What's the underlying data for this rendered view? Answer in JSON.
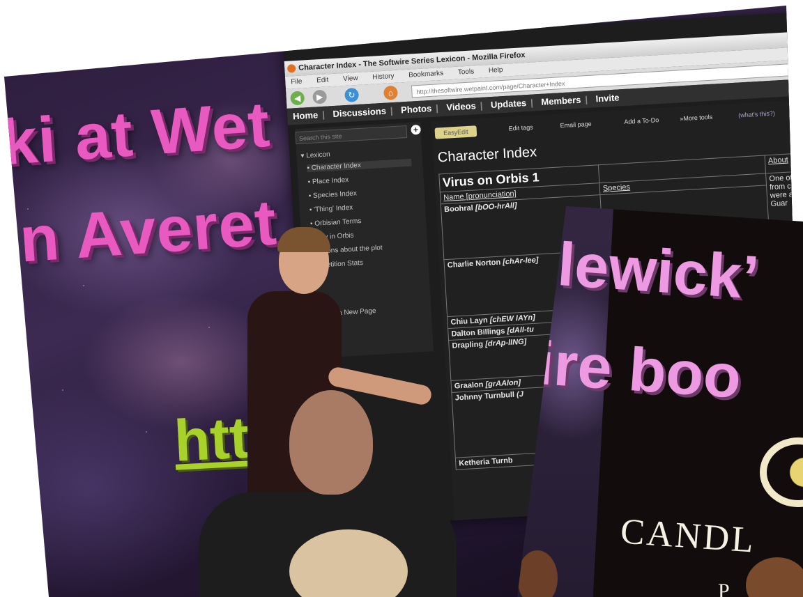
{
  "slide": {
    "title_line_1": "ki at Wet",
    "title_line_2": "n Averet",
    "url_fragment": "htt"
  },
  "browser": {
    "window_title": "Character Index - The Softwire Series Lexicon - Mozilla Firefox",
    "menu": [
      "File",
      "Edit",
      "View",
      "History",
      "Bookmarks",
      "Tools",
      "Help"
    ],
    "address": "http://thesoftwire.wetpaint.com/page/Character+Index",
    "site_nav": [
      "Home",
      "Discussions",
      "Photos",
      "Videos",
      "Updates",
      "Members",
      "Invite"
    ],
    "sidebar": {
      "search_placeholder": "Search this site",
      "root": "Lexicon",
      "items": [
        "Character Index",
        "Place Index",
        "Species Index",
        "'Thing' Index",
        "Orbisian Terms",
        "Day in Orbis",
        "estions about the plot",
        "mpetition Stats"
      ],
      "add_page": "Add a New Page"
    },
    "content": {
      "easy_edit": "EasyEdit",
      "tools": [
        "Edit tags",
        "Email page",
        "Add a To-Do",
        "»More tools",
        "(what's this?)"
      ],
      "page_title": "Character Index",
      "table": {
        "section": "Virus on Orbis 1",
        "header_name": "Name [pronunciation]",
        "header_species": "Species",
        "header_about": "About",
        "about_snippet": "One of\nfrom c\nwere a\nGuar",
        "rows": [
          {
            "name": "Boohral",
            "pron": "[bOO-hrAll]"
          },
          {
            "name": "Charlie Norton",
            "pron": "[chAr-lee]"
          },
          {
            "name": "Chiu Layn",
            "pron": "[chEW lAYn]"
          },
          {
            "name": "Dalton Billings",
            "pron": "[dAll-tu"
          },
          {
            "name": "Drapling",
            "pron": "[drAp-lING]"
          },
          {
            "name": "Graalon",
            "pron": "[grAAlon]"
          },
          {
            "name": "Johnny Turnbull",
            "pron": "(J"
          },
          {
            "name": "Ketheria Turnb",
            "pron": ""
          }
        ]
      }
    }
  },
  "right_photo": {
    "line_1": "lewick’",
    "line_2": "ire boo",
    "brand": "CANDL",
    "sub": "P"
  }
}
